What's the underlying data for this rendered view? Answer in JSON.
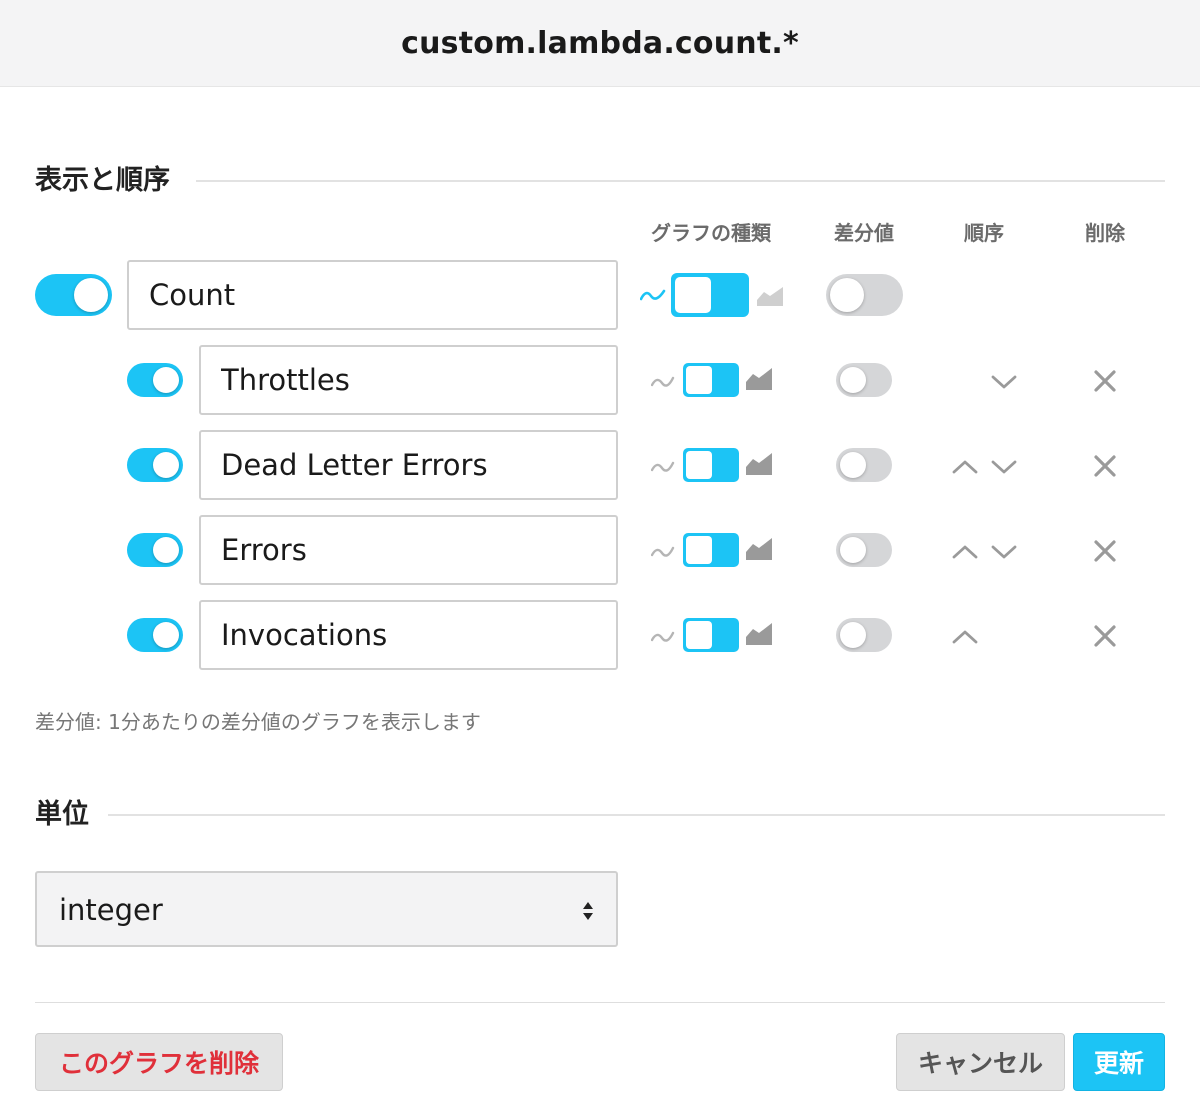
{
  "header": {
    "title": "custom.lambda.count.*"
  },
  "display_section": {
    "title": "表示と順序",
    "columns": {
      "graph_type": "グラフの種類",
      "diff": "差分値",
      "order": "順序",
      "delete": "削除"
    },
    "main_series": {
      "label": "Count",
      "visible": true,
      "graph_type": "line",
      "diff": false
    },
    "series": [
      {
        "label": "Throttles",
        "visible": true,
        "graph_type": "line",
        "diff": false,
        "can_move_up": false,
        "can_move_down": true
      },
      {
        "label": "Dead Letter Errors",
        "visible": true,
        "graph_type": "line",
        "diff": false,
        "can_move_up": true,
        "can_move_down": true
      },
      {
        "label": "Errors",
        "visible": true,
        "graph_type": "line",
        "diff": false,
        "can_move_up": true,
        "can_move_down": true
      },
      {
        "label": "Invocations",
        "visible": true,
        "graph_type": "line",
        "diff": false,
        "can_move_up": true,
        "can_move_down": false
      }
    ],
    "note": "差分値: 1分あたりの差分値のグラフを表示します"
  },
  "unit_section": {
    "title": "単位",
    "selected": "integer"
  },
  "footer": {
    "delete_label": "このグラフを削除",
    "cancel_label": "キャンセル",
    "update_label": "更新"
  },
  "colors": {
    "accent": "#1cc4f5",
    "danger": "#e0303a",
    "toggle_off": "#d5d6d8",
    "icon_gray": "#b5b5b5"
  }
}
